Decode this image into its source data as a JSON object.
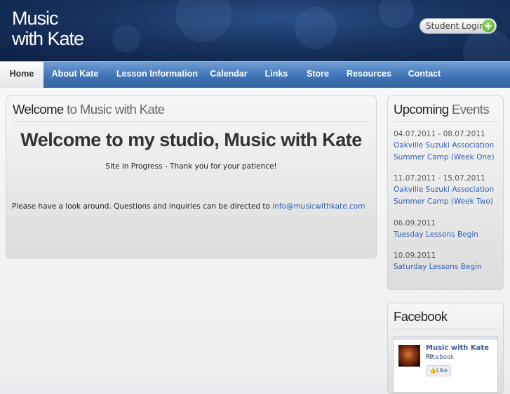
{
  "site": {
    "logo_line1": "Music",
    "logo_line2": "with Kate"
  },
  "header": {
    "login_label": "Student Login"
  },
  "nav": {
    "items": [
      {
        "label": "Home"
      },
      {
        "label": "About Kate"
      },
      {
        "label": "Lesson Information ⌄"
      },
      {
        "label": "Calendar"
      },
      {
        "label": "Links"
      },
      {
        "label": "Store"
      },
      {
        "label": "Resources"
      },
      {
        "label": "Contact"
      }
    ]
  },
  "welcome": {
    "title_first": "Welcome",
    "title_rest": " to Music with Kate",
    "heading": "Welcome to my studio, Music with Kate",
    "progress_text": "Site in Progress - Thank you for your patience!",
    "contact_text": "Please have a look around. Questions and inquiries can be directed to ",
    "contact_email": "info@musicwithkate.com"
  },
  "events": {
    "title_first": "Upcoming",
    "title_rest": " Events",
    "items": [
      {
        "date": "04.07.2011 - 08.07.2011",
        "title": "Oakville Suzuki Association Summer Camp (Week One)"
      },
      {
        "date": "11.07.2011 - 15.07.2011",
        "title": "Oakville Suzuki Association Summer Camp (Week Two)"
      },
      {
        "date": "06.09.2011",
        "title": "Tuesday Lessons Begin"
      },
      {
        "date": "10.09.2011",
        "title": "Saturday Lessons Begin"
      }
    ]
  },
  "facebook": {
    "title": "Facebook",
    "page_name": "Music with Kate",
    "on_text": " on",
    "sub_text": "Facebook",
    "like_label": "Like"
  },
  "colors": {
    "header_bg": "#183461",
    "nav_bg": "#3f74b8",
    "link": "#2d5fb3",
    "login_plus": "#4b9e22"
  }
}
